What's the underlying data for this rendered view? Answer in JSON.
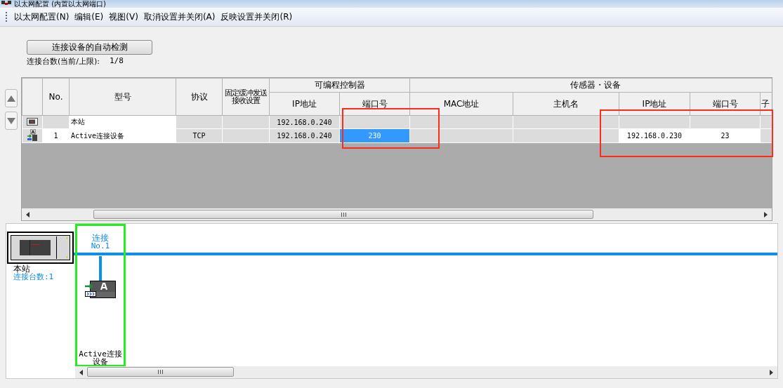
{
  "window": {
    "title": "以太网配置 (内置以太网端口)"
  },
  "menu": [
    {
      "label": "以太网配置(N)"
    },
    {
      "label": "编辑(E)"
    },
    {
      "label": "视图(V)"
    },
    {
      "label": "取消设置并关闭(A)"
    },
    {
      "label": "反映设置并关闭(R)"
    }
  ],
  "toolbar": {
    "detect_button": "连接设备的自动检测",
    "count_label": "连接台数(当前/上限):",
    "count_value": "1/8"
  },
  "table": {
    "columns": [
      "No.",
      "型号",
      "协议",
      "固定缓冲发送接收设置"
    ],
    "groups": [
      {
        "label": "可编程控制器",
        "columns": [
          "IP地址",
          "端口号"
        ]
      },
      {
        "label": "传感器・设备",
        "columns": [
          "MAC地址",
          "主机名",
          "IP地址",
          "端口号",
          "子"
        ]
      }
    ],
    "rows": [
      {
        "kind": "station",
        "cells": [
          {
            "editable": false,
            "selected": false
          },
          {
            "text": "本站",
            "editable": true,
            "selected": false
          },
          {
            "editable": false,
            "selected": false
          },
          {
            "editable": false,
            "selected": false
          },
          {
            "text": "192.168.0.240",
            "editable": false,
            "selected": false
          },
          {
            "editable": false,
            "selected": false
          },
          {
            "editable": false,
            "selected": false
          },
          {
            "editable": false,
            "selected": false
          },
          {
            "editable": false,
            "selected": false
          },
          {
            "editable": false,
            "selected": false
          },
          {
            "editable": false,
            "selected": false
          }
        ]
      },
      {
        "kind": "active",
        "cells": [
          {
            "text": "1",
            "editable": true,
            "selected": false
          },
          {
            "text": "Active连接设备",
            "editable": true,
            "selected": false
          },
          {
            "text": "TCP",
            "editable": false,
            "selected": false
          },
          {
            "editable": false,
            "selected": false
          },
          {
            "text": "192.168.0.240",
            "editable": false,
            "selected": false
          },
          {
            "text": "230",
            "editable": true,
            "selected": true
          },
          {
            "editable": false,
            "selected": false
          },
          {
            "editable": false,
            "selected": false
          },
          {
            "text": "192.168.0.230",
            "editable": true,
            "selected": false
          },
          {
            "text": "23",
            "editable": true,
            "selected": false
          },
          {
            "editable": false,
            "selected": false
          }
        ]
      }
    ]
  },
  "diagram": {
    "station": {
      "label": "本站",
      "count": "连接台数:1"
    },
    "connections": [
      {
        "label": "连接",
        "no": "No.1",
        "device": "Active连接设备",
        "selected": true
      }
    ]
  }
}
